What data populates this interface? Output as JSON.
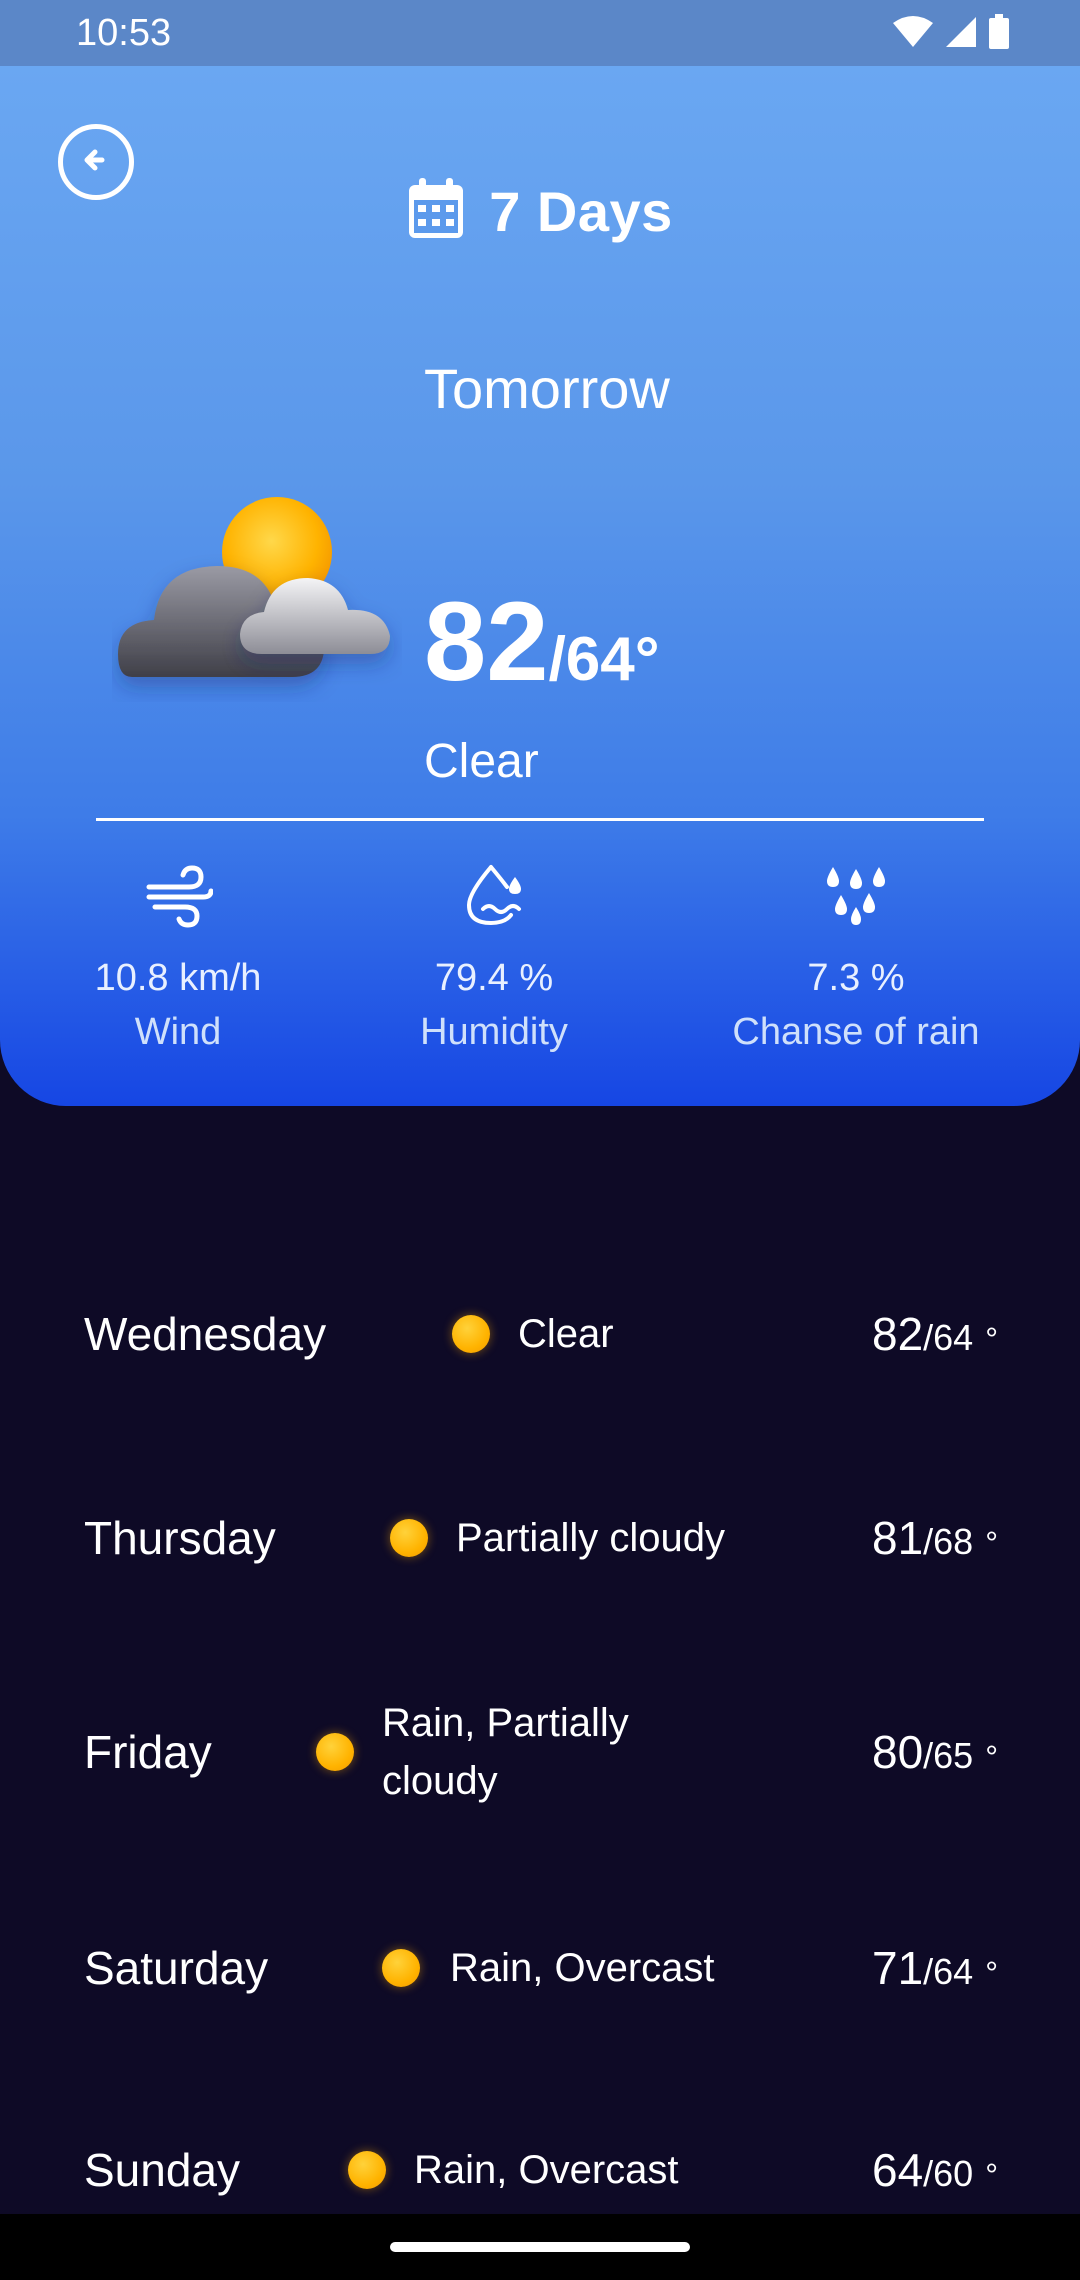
{
  "status_bar": {
    "time": "10:53",
    "icons": [
      "wifi-icon",
      "signal-icon",
      "battery-icon"
    ]
  },
  "header": {
    "back_icon": "arrow-left-circle-icon",
    "title_icon": "calendar-icon",
    "title": "7 Days"
  },
  "today": {
    "day": "Tomorrow",
    "icon": "sun-behind-clouds-icon",
    "high": "82",
    "low": "/64°",
    "condition": "Clear"
  },
  "stats": [
    {
      "icon": "wind-icon",
      "value": "10.8 km/h",
      "label": "Wind"
    },
    {
      "icon": "humidity-icon",
      "value": "79.4 %",
      "label": "Humidity"
    },
    {
      "icon": "rain-drops-icon",
      "value": "7.3 %",
      "label": "Chanse of rain"
    }
  ],
  "forecast": [
    {
      "day": "Wednesday",
      "condition": "Clear",
      "high": "82",
      "low": "/64",
      "deg": "°"
    },
    {
      "day": "Thursday",
      "condition": "Partially cloudy",
      "high": "81",
      "low": "/68",
      "deg": "°"
    },
    {
      "day": "Friday",
      "condition_line1": "Rain, Partially",
      "condition_line2": "cloudy",
      "high": "80",
      "low": "/65",
      "deg": "°"
    },
    {
      "day": "Saturday",
      "condition": "Rain, Overcast",
      "high": "71",
      "low": "/64",
      "deg": "°"
    },
    {
      "day": "Sunday",
      "condition": "Rain, Overcast",
      "high": "64",
      "low": "/60",
      "deg": "°"
    }
  ],
  "colors": {
    "hero_top": "#6aa7f2",
    "hero_bottom": "#1646e4",
    "background": "#0e0a26",
    "sun": "#ffb300"
  }
}
